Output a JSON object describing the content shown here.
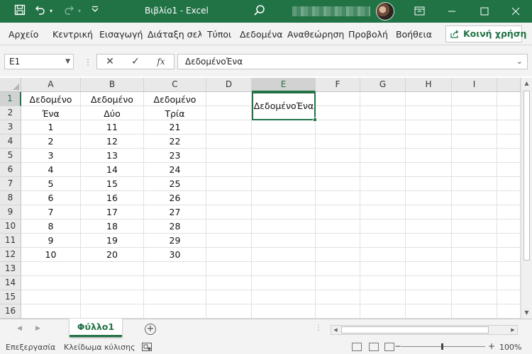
{
  "titlebar": {
    "title": "Βιβλίο1  -  Excel",
    "icons": [
      "save-icon",
      "undo-icon",
      "redo-icon",
      "customize-icon",
      "search-icon",
      "ribbon-display-icon",
      "minimize-icon",
      "maximize-icon",
      "close-icon"
    ]
  },
  "ribbon": {
    "tabs": [
      "Αρχείο",
      "Κεντρική",
      "Εισαγωγή",
      "Διάταξη σελί",
      "Τύποι",
      "Δεδομένα",
      "Αναθεώρηση",
      "Προβολή",
      "Βοήθεια"
    ],
    "share_label": "Κοινή χρήση"
  },
  "formula_bar": {
    "name_box": "E1",
    "fx_label": "fx",
    "content": "ΔεδομένοΈνα"
  },
  "grid": {
    "columns": [
      "A",
      "B",
      "C",
      "D",
      "E",
      "F",
      "G",
      "H",
      "I"
    ],
    "rows": [
      "1",
      "2",
      "3",
      "4",
      "5",
      "6",
      "7",
      "8",
      "9",
      "10",
      "11",
      "12",
      "13",
      "14",
      "15",
      "16"
    ],
    "selected_cell": "E1",
    "headers": {
      "a": [
        "Δεδομένο",
        "Ένα"
      ],
      "b": [
        "Δεδομένο",
        "Δύο"
      ],
      "c": [
        "Δεδομένο",
        "Τρία"
      ]
    },
    "values": {
      "a": [
        "1",
        "2",
        "3",
        "4",
        "5",
        "6",
        "7",
        "8",
        "9",
        "10"
      ],
      "b": [
        "11",
        "12",
        "13",
        "14",
        "15",
        "16",
        "17",
        "18",
        "19",
        "20"
      ],
      "c": [
        "21",
        "22",
        "23",
        "24",
        "25",
        "26",
        "27",
        "28",
        "29",
        "30"
      ]
    },
    "e1_value": "ΔεδομένοΈνα"
  },
  "sheets": {
    "tabs": [
      "Φύλλο1"
    ],
    "add_label": "+"
  },
  "status_bar": {
    "mode": "Επεξεργασία",
    "scroll_lock": "Κλείδωμα κύλισης",
    "zoom": "100%"
  },
  "colors": {
    "accent": "#217346",
    "chrome": "#f3f3f3"
  }
}
